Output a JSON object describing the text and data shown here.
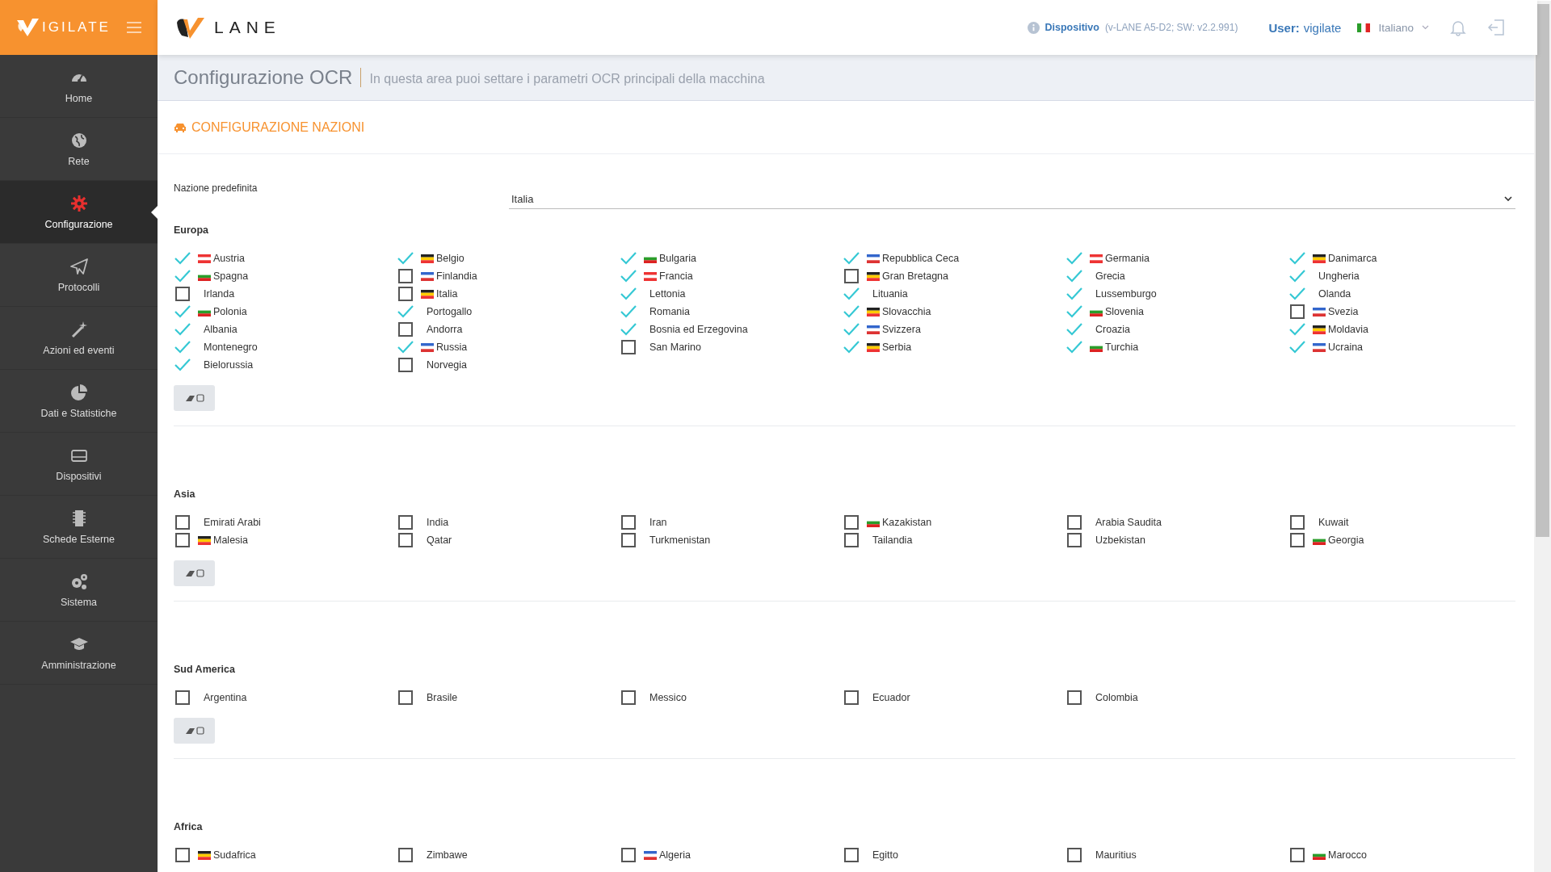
{
  "brand": {
    "sidebar_logo_text": "IGILATE",
    "header_logo_text": "LANE"
  },
  "header": {
    "device_label": "Dispositivo",
    "device_info": "(v-LANE A5-D2; SW: v2.2.991)",
    "user_label": "User:",
    "user_name": "vigilate",
    "language": "Italiano"
  },
  "sidebar": {
    "items": [
      {
        "label": "Home",
        "selected": false
      },
      {
        "label": "Rete",
        "selected": false
      },
      {
        "label": "Configurazione",
        "selected": true
      },
      {
        "label": "Protocolli",
        "selected": false
      },
      {
        "label": "Azioni ed eventi",
        "selected": false
      },
      {
        "label": "Dati e Statistiche",
        "selected": false
      },
      {
        "label": "Dispositivi",
        "selected": false
      },
      {
        "label": "Schede Esterne",
        "selected": false
      },
      {
        "label": "Sistema",
        "selected": false
      },
      {
        "label": "Amministrazione",
        "selected": false
      }
    ]
  },
  "page": {
    "title": "Configurazione OCR",
    "subtitle": "In questa area puoi settare i parametri OCR principali della macchina"
  },
  "panel": {
    "title": "CONFIGURAZIONE NAZIONI",
    "default_nation": {
      "label": "Nazione predefinita",
      "value": "Italia"
    },
    "regions": [
      {
        "title": "Europa",
        "countries": [
          {
            "name": "Austria",
            "checked": true,
            "flag": true
          },
          {
            "name": "Belgio",
            "checked": true,
            "flag": true
          },
          {
            "name": "Bulgaria",
            "checked": true,
            "flag": true
          },
          {
            "name": "Repubblica Ceca",
            "checked": true,
            "flag": true
          },
          {
            "name": "Germania",
            "checked": true,
            "flag": true
          },
          {
            "name": "Danimarca",
            "checked": true,
            "flag": true
          },
          {
            "name": "Spagna",
            "checked": true,
            "flag": true
          },
          {
            "name": "Finlandia",
            "checked": false,
            "flag": true
          },
          {
            "name": "Francia",
            "checked": true,
            "flag": true
          },
          {
            "name": "Gran Bretagna",
            "checked": false,
            "flag": true
          },
          {
            "name": "Grecia",
            "checked": true,
            "flag": false
          },
          {
            "name": "Ungheria",
            "checked": true,
            "flag": false
          },
          {
            "name": "Irlanda",
            "checked": false,
            "flag": false
          },
          {
            "name": "Italia",
            "checked": false,
            "flag": true
          },
          {
            "name": "Lettonia",
            "checked": true,
            "flag": false
          },
          {
            "name": "Lituania",
            "checked": true,
            "flag": false
          },
          {
            "name": "Lussemburgo",
            "checked": true,
            "flag": false
          },
          {
            "name": "Olanda",
            "checked": true,
            "flag": false
          },
          {
            "name": "Polonia",
            "checked": true,
            "flag": true
          },
          {
            "name": "Portogallo",
            "checked": true,
            "flag": false
          },
          {
            "name": "Romania",
            "checked": true,
            "flag": false
          },
          {
            "name": "Slovacchia",
            "checked": true,
            "flag": true
          },
          {
            "name": "Slovenia",
            "checked": true,
            "flag": true
          },
          {
            "name": "Svezia",
            "checked": false,
            "flag": true
          },
          {
            "name": "Albania",
            "checked": true,
            "flag": false
          },
          {
            "name": "Andorra",
            "checked": false,
            "flag": false
          },
          {
            "name": "Bosnia ed Erzegovina",
            "checked": true,
            "flag": false
          },
          {
            "name": "Svizzera",
            "checked": true,
            "flag": true
          },
          {
            "name": "Croazia",
            "checked": true,
            "flag": false
          },
          {
            "name": "Moldavia",
            "checked": true,
            "flag": true
          },
          {
            "name": "Montenegro",
            "checked": true,
            "flag": false
          },
          {
            "name": "Russia",
            "checked": true,
            "flag": true
          },
          {
            "name": "San Marino",
            "checked": false,
            "flag": false
          },
          {
            "name": "Serbia",
            "checked": true,
            "flag": true
          },
          {
            "name": "Turchia",
            "checked": true,
            "flag": true
          },
          {
            "name": "Ucraina",
            "checked": true,
            "flag": true
          },
          {
            "name": "Bielorussia",
            "checked": true,
            "flag": false
          },
          {
            "name": "Norvegia",
            "checked": false,
            "flag": false
          }
        ]
      },
      {
        "title": "Asia",
        "countries": [
          {
            "name": "Emirati Arabi",
            "checked": false,
            "flag": false
          },
          {
            "name": "India",
            "checked": false,
            "flag": false
          },
          {
            "name": "Iran",
            "checked": false,
            "flag": false
          },
          {
            "name": "Kazakistan",
            "checked": false,
            "flag": true
          },
          {
            "name": "Arabia Saudita",
            "checked": false,
            "flag": false
          },
          {
            "name": "Kuwait",
            "checked": false,
            "flag": false
          },
          {
            "name": "Malesia",
            "checked": false,
            "flag": true
          },
          {
            "name": "Qatar",
            "checked": false,
            "flag": false
          },
          {
            "name": "Turkmenistan",
            "checked": false,
            "flag": false
          },
          {
            "name": "Tailandia",
            "checked": false,
            "flag": false
          },
          {
            "name": "Uzbekistan",
            "checked": false,
            "flag": false
          },
          {
            "name": "Georgia",
            "checked": false,
            "flag": true
          }
        ]
      },
      {
        "title": "Sud America",
        "countries": [
          {
            "name": "Argentina",
            "checked": false,
            "flag": false
          },
          {
            "name": "Brasile",
            "checked": false,
            "flag": false
          },
          {
            "name": "Messico",
            "checked": false,
            "flag": false
          },
          {
            "name": "Ecuador",
            "checked": false,
            "flag": false
          },
          {
            "name": "Colombia",
            "checked": false,
            "flag": false
          }
        ]
      },
      {
        "title": "Africa",
        "countries": [
          {
            "name": "Sudafrica",
            "checked": false,
            "flag": true
          },
          {
            "name": "Zimbawe",
            "checked": false,
            "flag": false
          },
          {
            "name": "Algeria",
            "checked": false,
            "flag": true
          },
          {
            "name": "Egitto",
            "checked": false,
            "flag": false
          },
          {
            "name": "Mauritius",
            "checked": false,
            "flag": false
          },
          {
            "name": "Marocco",
            "checked": false,
            "flag": true
          }
        ]
      }
    ]
  }
}
